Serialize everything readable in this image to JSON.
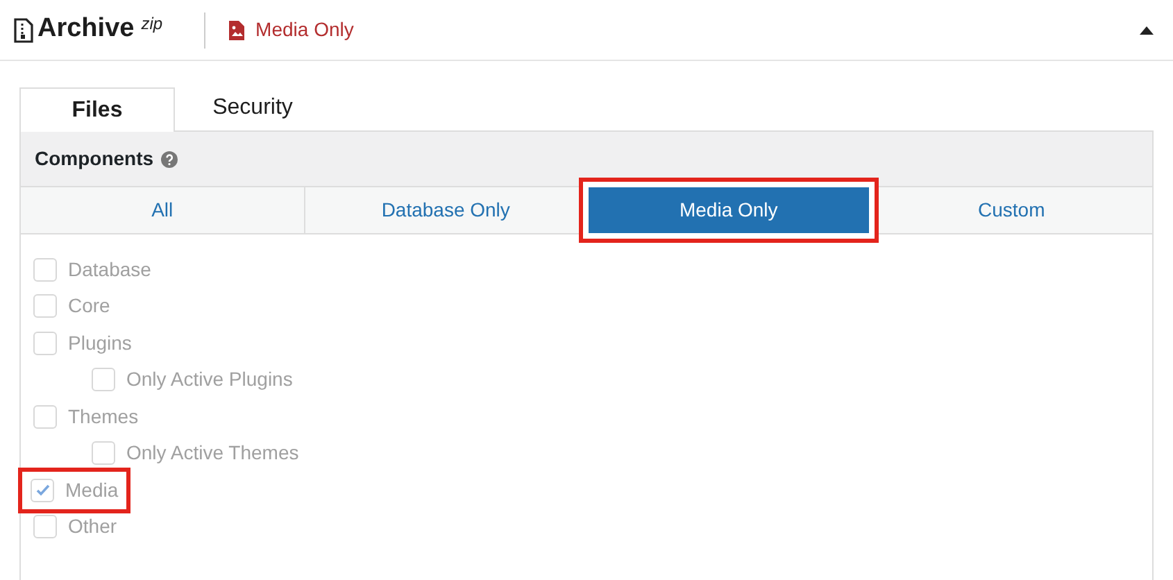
{
  "header": {
    "title": "Archive",
    "superscript": "zip",
    "mode": "Media Only",
    "expanded": true
  },
  "tabs": [
    {
      "label": "Files",
      "selected": true
    },
    {
      "label": "Security",
      "selected": false
    }
  ],
  "components": {
    "title": "Components",
    "presets": [
      {
        "label": "All",
        "selected": false,
        "highlighted": false
      },
      {
        "label": "Database Only",
        "selected": false,
        "highlighted": false
      },
      {
        "label": "Media Only",
        "selected": true,
        "highlighted": true
      },
      {
        "label": "Custom",
        "selected": false,
        "highlighted": false
      }
    ],
    "items": [
      {
        "label": "Database",
        "checked": false,
        "disabled": true,
        "highlighted": false
      },
      {
        "label": "Core",
        "checked": false,
        "disabled": true,
        "highlighted": false
      },
      {
        "label": "Plugins",
        "checked": false,
        "disabled": true,
        "highlighted": false,
        "children": [
          {
            "label": "Only Active Plugins",
            "checked": false,
            "disabled": true,
            "highlighted": false
          }
        ]
      },
      {
        "label": "Themes",
        "checked": false,
        "disabled": true,
        "highlighted": false,
        "children": [
          {
            "label": "Only Active Themes",
            "checked": false,
            "disabled": true,
            "highlighted": false
          }
        ]
      },
      {
        "label": "Media",
        "checked": true,
        "disabled": true,
        "highlighted": true
      },
      {
        "label": "Other",
        "checked": false,
        "disabled": true,
        "highlighted": false
      }
    ]
  }
}
